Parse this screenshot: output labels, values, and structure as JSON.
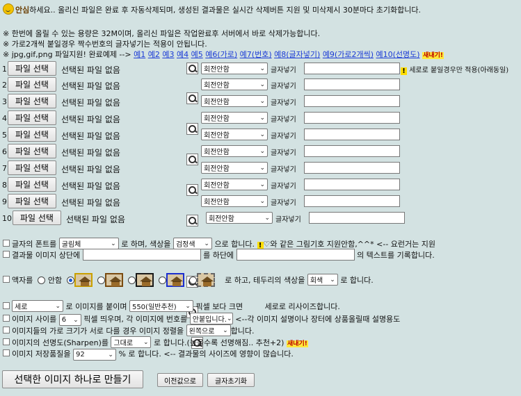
{
  "notice": {
    "highlight": "안심",
    "rest": "하세요.. 올리신 파일은 완료 후 자동삭제되며, 생성된 결과물은 실시간 삭제버튼 지원 및 미삭제시 30분마다 초기화합니다."
  },
  "info_lines": [
    "※ 한번에 올릴 수 있는 용량은 32M이며, 올리신 파일은 작업완료후 서버에서 바로 삭제가능합니다.",
    "※ 가로2개씩 붙일경우 짝수번호의 글자넣기는 적용이 안됩니다."
  ],
  "examples": {
    "prefix": "※ jpg,gif,png 파일지원! 완료예제 -->",
    "links": [
      "예1",
      "예2",
      "예3",
      "예4",
      "예5",
      "예6(가로)",
      "예7(번호)",
      "예8(글자넣기)",
      "예9(가로2개씩)",
      "예10(선명도)"
    ],
    "badge": "새내기!"
  },
  "file_rows": {
    "button": "파일 선택",
    "status": "선택된 파일 없음",
    "rotate": "회전안함",
    "text_label": "글자넣기",
    "numbers": [
      "1.",
      "2.",
      "3.",
      "4.",
      "5.",
      "6.",
      "7.",
      "8.",
      "9.",
      "10."
    ],
    "row1_note": "세로로 붙일경우만 적용(아래동일)"
  },
  "options": {
    "font_prefix": "글자의 폰트를",
    "font_value": "굴림체",
    "font_mid": "로 하며, 색상을",
    "color_value": "검정색",
    "font_suffix": "으로 합니다.",
    "font_note": "♡와 같은 그림기호 지원안함,^^* <-- 요런거는 지원",
    "caption_prefix": "결과물 이미지 상단에",
    "caption_mid": "를 하단에",
    "caption_suffix": "의 텍스트를 기록합니다.",
    "frame_prefix": "액자를",
    "frame_none": "안함",
    "border_text": "로 하고, 테두리의 색상을",
    "border_value": "회색",
    "border_suffix": "로 합니다.",
    "orient_value": "세로",
    "orient_text": "로 이미지를 붙이며",
    "width_value": "550(일반추천)",
    "width_text1": "픽셀 보다 크면",
    "width_text2": "세로로 리사이즈합니다.",
    "gap_prefix": "이미지 사이를",
    "gap_value": "6",
    "gap_text": "픽셀 띄우며, 각 이미지에 번호를",
    "number_value": "안붙입니다.",
    "number_text": "<--각 이미지 설명이나 장터에 상품올릴때 설명용도",
    "align_prefix": "이미지들의 가로 크기가 서로 다를 경우 이미지 정렬을",
    "align_value": "왼쪽으로",
    "align_suffix": "합니다.",
    "sharpen_prefix": "이미지의 선명도(Sharpen)를",
    "sharpen_value": "그대로",
    "sharpen_text": "로 합니다.(높을수록 선명해짐.. 추천+2)",
    "sharpen_badge": "새내기!",
    "quality_prefix": "이미지 저장품질을",
    "quality_value": "92",
    "quality_text": "% 로 합니다. <-- 결과물의 사이즈에 영향이 많습니다."
  },
  "actions": {
    "make": "선택한 이미지 하나로 만들기",
    "prev": "이전값으로",
    "reset": "글자초기화"
  }
}
